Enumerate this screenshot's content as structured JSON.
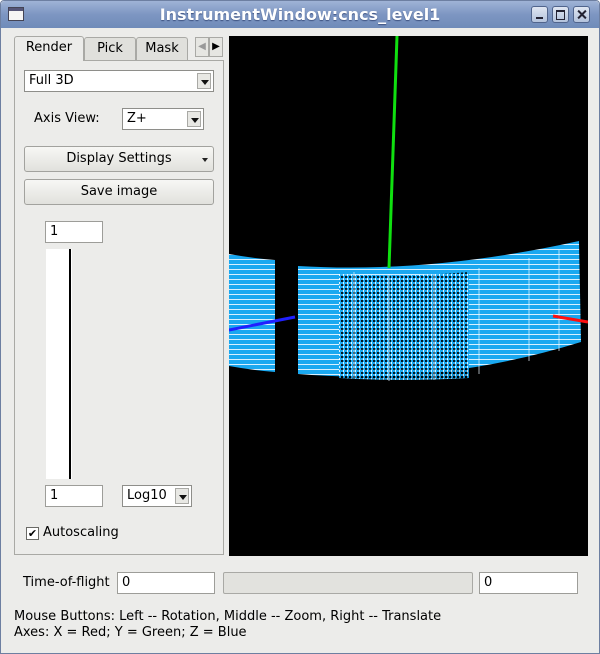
{
  "window": {
    "title": "InstrumentWindow:cncs_level1"
  },
  "tabs": [
    {
      "label": "Render",
      "active": true
    },
    {
      "label": "Pick",
      "active": false
    },
    {
      "label": "Mask",
      "active": false
    }
  ],
  "render_panel": {
    "render_mode": "Full 3D",
    "axis_view_label": "Axis View:",
    "axis_view_value": "Z+",
    "display_settings_label": "Display Settings",
    "save_image_label": "Save image",
    "colormap_max": "1",
    "colormap_min": "1",
    "scale_type": "Log10",
    "autoscaling_label": "Autoscaling",
    "autoscaling_checked": true,
    "check_glyph": "✔"
  },
  "viewport": {
    "background": "#000000",
    "detector_color": "#1aa8f0",
    "axes": {
      "x_color": "#ff1010",
      "y_color": "#10e010",
      "z_color": "#2020ff"
    }
  },
  "bottom_bar": {
    "tof_label": "Time-of-flight",
    "tof_min": "0",
    "tof_max": "0"
  },
  "status": {
    "line1": "Mouse Buttons: Left -- Rotation, Middle -- Zoom, Right -- Translate",
    "line2": "Axes: X = Red; Y = Green; Z = Blue"
  }
}
